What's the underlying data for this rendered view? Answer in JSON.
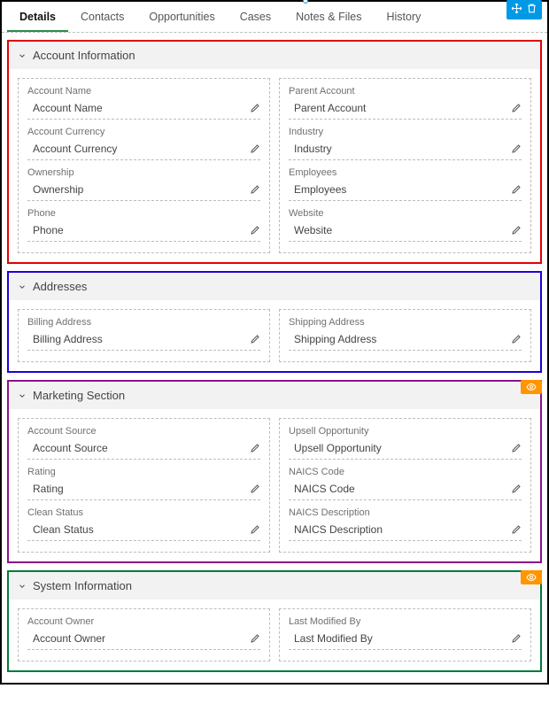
{
  "tabs": [
    {
      "id": "details",
      "label": "Details",
      "active": true
    },
    {
      "id": "contacts",
      "label": "Contacts",
      "active": false
    },
    {
      "id": "opportunities",
      "label": "Opportunities",
      "active": false
    },
    {
      "id": "cases",
      "label": "Cases",
      "active": false
    },
    {
      "id": "notes",
      "label": "Notes & Files",
      "active": false
    },
    {
      "id": "history",
      "label": "History",
      "active": false
    }
  ],
  "sections": {
    "account": {
      "title": "Account Information",
      "left": [
        {
          "label": "Account Name",
          "value": "Account Name"
        },
        {
          "label": "Account Currency",
          "value": "Account Currency"
        },
        {
          "label": "Ownership",
          "value": "Ownership"
        },
        {
          "label": "Phone",
          "value": "Phone"
        }
      ],
      "right": [
        {
          "label": "Parent Account",
          "value": "Parent Account"
        },
        {
          "label": "Industry",
          "value": "Industry"
        },
        {
          "label": "Employees",
          "value": "Employees"
        },
        {
          "label": "Website",
          "value": "Website"
        }
      ]
    },
    "addresses": {
      "title": "Addresses",
      "left": [
        {
          "label": "Billing Address",
          "value": "Billing Address"
        }
      ],
      "right": [
        {
          "label": "Shipping Address",
          "value": "Shipping Address"
        }
      ]
    },
    "marketing": {
      "title": "Marketing Section",
      "left": [
        {
          "label": "Account Source",
          "value": "Account Source"
        },
        {
          "label": "Rating",
          "value": "Rating"
        },
        {
          "label": "Clean Status",
          "value": "Clean Status"
        }
      ],
      "right": [
        {
          "label": "Upsell Opportunity",
          "value": "Upsell Opportunity"
        },
        {
          "label": "NAICS Code",
          "value": "NAICS Code"
        },
        {
          "label": "NAICS Description",
          "value": "NAICS Description"
        }
      ]
    },
    "system": {
      "title": "System Information",
      "left": [
        {
          "label": "Account Owner",
          "value": "Account Owner"
        }
      ],
      "right": [
        {
          "label": "Last Modified By",
          "value": "Last Modified By"
        }
      ]
    }
  }
}
